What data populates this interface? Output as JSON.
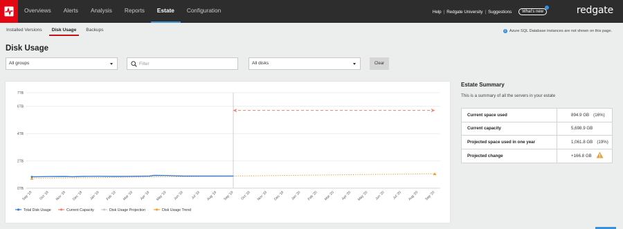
{
  "nav": {
    "items": [
      {
        "label": "Overviews",
        "active": false
      },
      {
        "label": "Alerts",
        "active": false
      },
      {
        "label": "Analysis",
        "active": false
      },
      {
        "label": "Reports",
        "active": false
      },
      {
        "label": "Estate",
        "active": true
      },
      {
        "label": "Configuration",
        "active": false
      }
    ],
    "help": "Help",
    "university": "Redgate University",
    "suggestions": "Suggestions",
    "whats_new": "What's new",
    "brand": "redgate"
  },
  "subtabs": [
    {
      "label": "Installed Versions",
      "active": false
    },
    {
      "label": "Disk Usage",
      "active": true
    },
    {
      "label": "Backups",
      "active": false
    }
  ],
  "notice": "Azure SQL Database instances are not shown on this page.",
  "page_title": "Disk Usage",
  "filters": {
    "groups": "All groups",
    "search_placeholder": "Filter",
    "disks": "All disks",
    "clear": "Clear"
  },
  "chart_data": {
    "type": "line",
    "y_ticks": [
      "0TB",
      "2TB",
      "4TB",
      "6TB",
      "7TB"
    ],
    "ylim": [
      0,
      7
    ],
    "x_ticks": [
      "Sep '18",
      "Oct '18",
      "Nov '18",
      "Dec '18",
      "Jan '19",
      "Feb '19",
      "Mar '19",
      "Apr '19",
      "May '19",
      "Jun '19",
      "Jul '19",
      "Aug '19",
      "Sep '19",
      "Oct '19",
      "Nov '19",
      "Dec '19",
      "Jan '20",
      "Feb '20",
      "Mar '20",
      "Apr '20",
      "May '20",
      "Jun '20",
      "Jul '20",
      "Aug '20",
      "Sep '20"
    ],
    "series": [
      {
        "name": "Total Disk Usage",
        "color": "#3a7bd5",
        "x": [
          0,
          1,
          2,
          2.4,
          3,
          4,
          5,
          6,
          7,
          7.3,
          8,
          9,
          10,
          11,
          12
        ],
        "y": [
          0.83,
          0.85,
          0.86,
          0.84,
          0.86,
          0.87,
          0.86,
          0.87,
          0.89,
          0.94,
          0.93,
          0.89,
          0.89,
          0.89,
          0.89
        ]
      },
      {
        "name": "Current Capacity",
        "color": "#e8826a",
        "x": [
          12,
          24
        ],
        "y": [
          5.7,
          5.7
        ]
      },
      {
        "name": "Disk Usage Projection",
        "color": "#cccccc",
        "x": [],
        "y": []
      },
      {
        "name": "Disk Usage Trend",
        "color": "#f0a030",
        "x": [
          0,
          24
        ],
        "y": [
          0.72,
          1.06
        ]
      }
    ],
    "legend_position": "bottom-left",
    "grid": true
  },
  "summary": {
    "title": "Estate Summary",
    "description": "This is a summary of all the servers in your estate",
    "rows": [
      {
        "label": "Current space used",
        "value": "894.9 GB",
        "extra": "(16%)"
      },
      {
        "label": "Current capacity",
        "value": "5,698.9 GB",
        "extra": ""
      },
      {
        "label": "Projected space used in one year",
        "value": "1,061.8 GB",
        "extra": "(19%)"
      },
      {
        "label": "Projected change",
        "value": "+166.8 GB",
        "extra": "warning-icon"
      }
    ]
  }
}
